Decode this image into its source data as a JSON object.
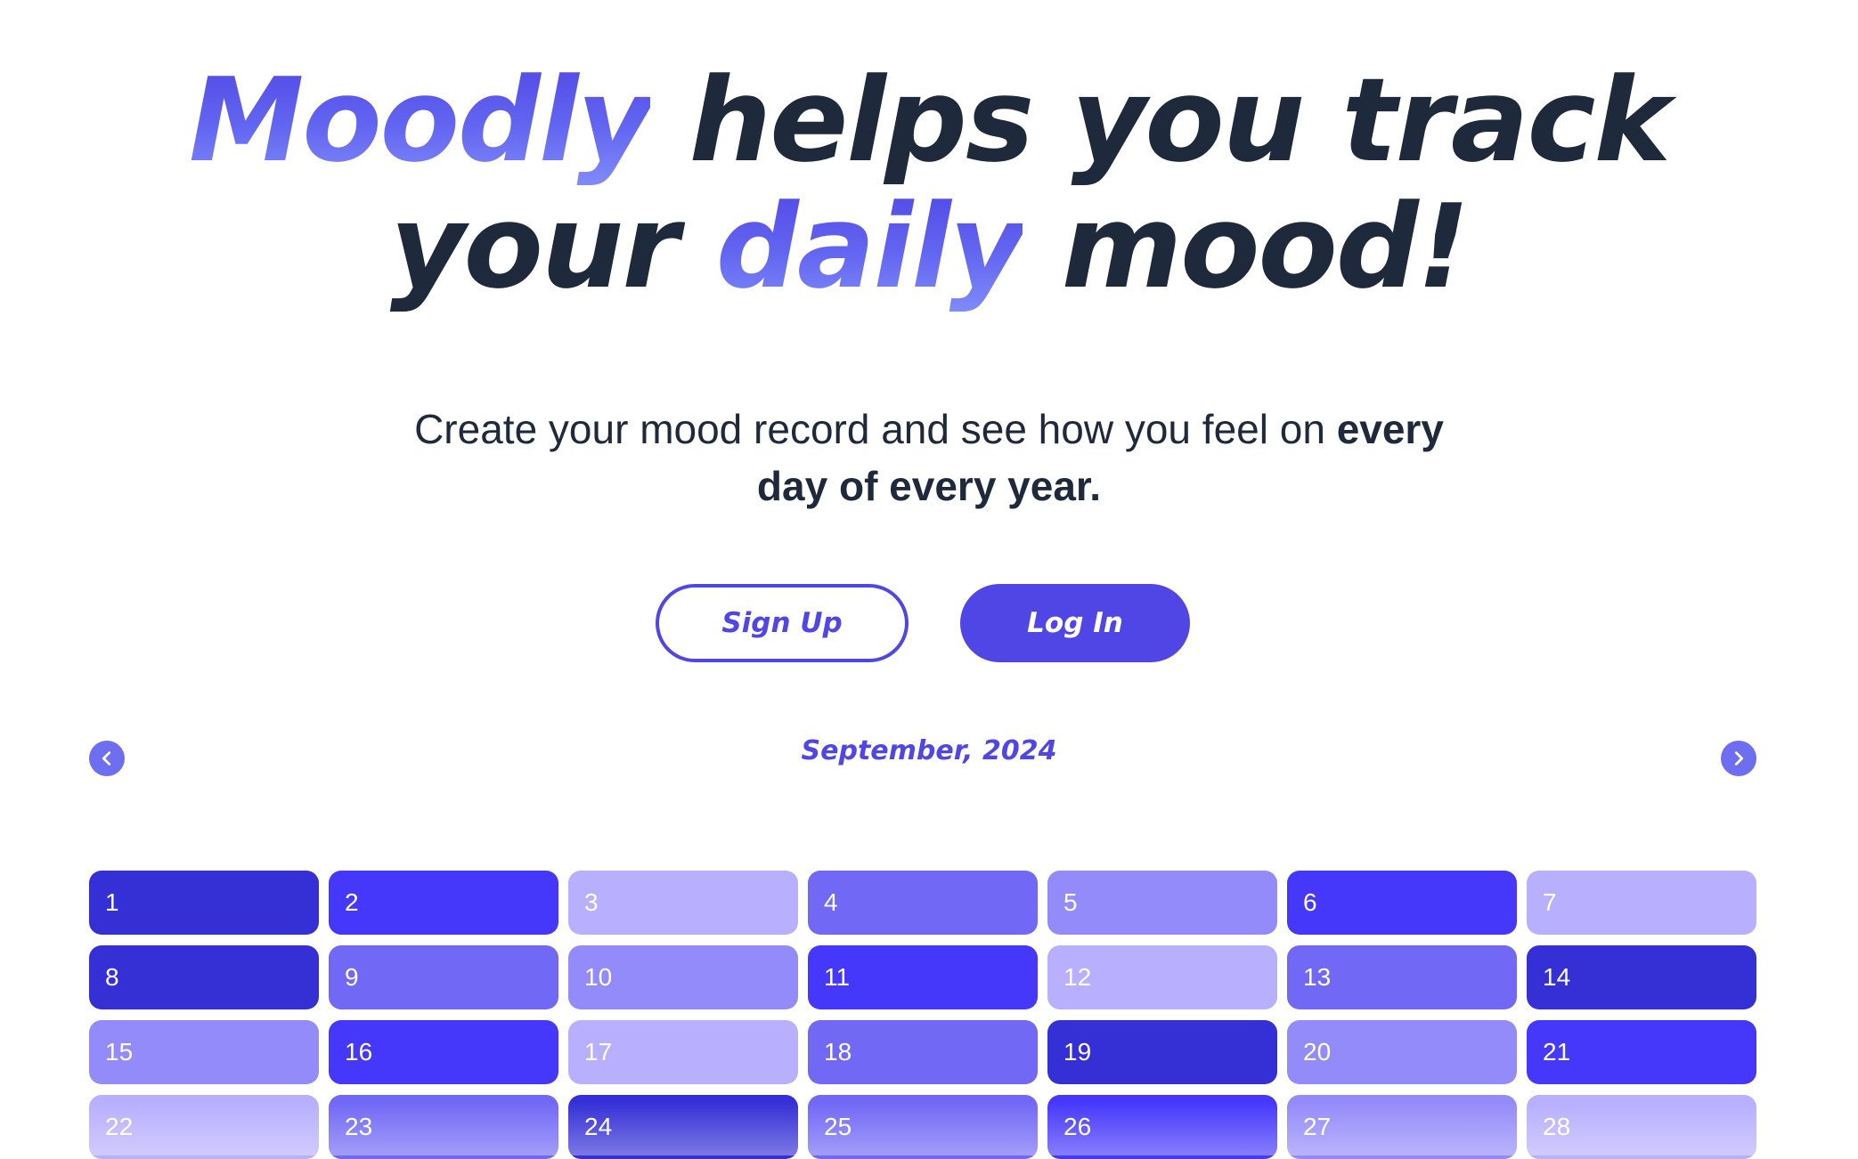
{
  "hero": {
    "title_line1_highlight": "Moodly",
    "title_line1_rest": "helps you track",
    "title_line2_start": "your",
    "title_line2_highlight": "daily",
    "title_line2_end": "mood!",
    "subtitle_plain": "Create your mood record and see how you feel on",
    "subtitle_bold": "every day of every year."
  },
  "actions": {
    "signup_label": "Sign Up",
    "login_label": "Log In"
  },
  "calendar": {
    "month_label": "September, 2024",
    "prev_icon": "chevron-left-icon",
    "next_icon": "chevron-right-icon",
    "mood_colors": {
      "1": "#3530d6",
      "2": "#4638fb",
      "3": "#7168f6",
      "4": "#948bfa",
      "5": "#b8affe"
    },
    "days": [
      {
        "label": "1",
        "mood": 1
      },
      {
        "label": "2",
        "mood": 2
      },
      {
        "label": "3",
        "mood": 5
      },
      {
        "label": "4",
        "mood": 3
      },
      {
        "label": "5",
        "mood": 4
      },
      {
        "label": "6",
        "mood": 2
      },
      {
        "label": "7",
        "mood": 5
      },
      {
        "label": "8",
        "mood": 1
      },
      {
        "label": "9",
        "mood": 3
      },
      {
        "label": "10",
        "mood": 4
      },
      {
        "label": "11",
        "mood": 2
      },
      {
        "label": "12",
        "mood": 5
      },
      {
        "label": "13",
        "mood": 3
      },
      {
        "label": "14",
        "mood": 1
      },
      {
        "label": "15",
        "mood": 4
      },
      {
        "label": "16",
        "mood": 2
      },
      {
        "label": "17",
        "mood": 5
      },
      {
        "label": "18",
        "mood": 3
      },
      {
        "label": "19",
        "mood": 1
      },
      {
        "label": "20",
        "mood": 4
      },
      {
        "label": "21",
        "mood": 2
      },
      {
        "label": "22",
        "mood": 5
      },
      {
        "label": "23",
        "mood": 3
      },
      {
        "label": "24",
        "mood": 1
      },
      {
        "label": "25",
        "mood": 3
      },
      {
        "label": "26",
        "mood": 2
      },
      {
        "label": "27",
        "mood": 4
      },
      {
        "label": "28",
        "mood": 5
      }
    ]
  }
}
